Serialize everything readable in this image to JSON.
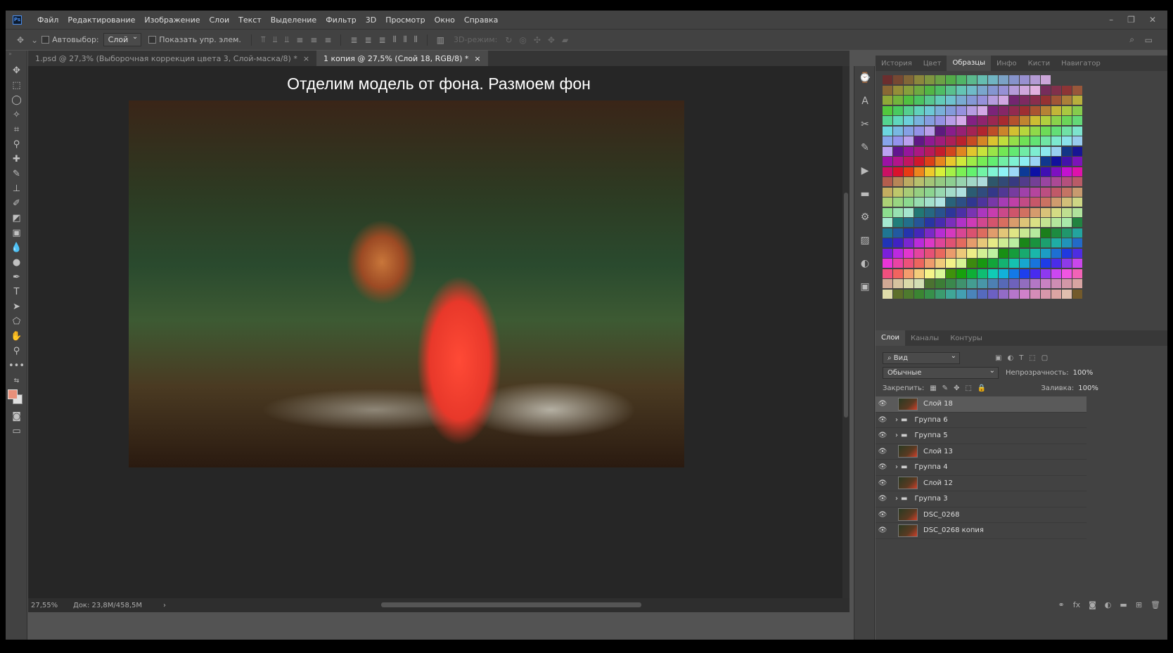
{
  "menu": [
    "Файл",
    "Редактирование",
    "Изображение",
    "Слои",
    "Текст",
    "Выделение",
    "Фильтр",
    "3D",
    "Просмотр",
    "Окно",
    "Справка"
  ],
  "options": {
    "autoselect": "Автовыбор:",
    "autoselect_value": "Слой",
    "show_controls": "Показать упр. элем.",
    "mode_3d": "3D-режим:"
  },
  "tabs": [
    {
      "label": "1.psd @ 27,3% (Выборочная коррекция цвета 3, Слой-маска/8) *"
    },
    {
      "label": "1 копия @ 27,5% (Слой 18, RGB/8) *"
    }
  ],
  "canvas": {
    "caption": "Отделим модель от фона. Размоем фон"
  },
  "status": {
    "zoom": "27,55%",
    "doc": "Док: 23,8M/458,5M"
  },
  "top_panel_tabs": [
    "История",
    "Цвет",
    "Образцы",
    "Инфо",
    "Кисти",
    "Навигатор"
  ],
  "layers_panel_tabs": [
    "Слои",
    "Каналы",
    "Контуры"
  ],
  "layers": {
    "filter": "Вид",
    "blend": "Обычные",
    "opacity_label": "Непрозрачность:",
    "opacity": "100%",
    "lock_label": "Закрепить:",
    "fill_label": "Заливка:",
    "fill": "100%",
    "items": [
      {
        "name": "Слой 18",
        "type": "layer",
        "selected": true
      },
      {
        "name": "Группа 6",
        "type": "group"
      },
      {
        "name": "Группа 5",
        "type": "group"
      },
      {
        "name": "Слой 13",
        "type": "layer"
      },
      {
        "name": "Группа 4",
        "type": "group"
      },
      {
        "name": "Слой 12",
        "type": "layer"
      },
      {
        "name": "Группа 3",
        "type": "group"
      },
      {
        "name": "DSC_0268",
        "type": "layer"
      },
      {
        "name": "DSC_0268 копия",
        "type": "layer"
      }
    ]
  }
}
